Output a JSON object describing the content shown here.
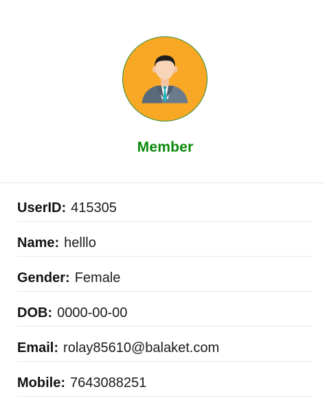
{
  "profile": {
    "avatar_icon": "businessman-avatar-icon",
    "role": "Member",
    "colors": {
      "role_text": "#0a8a0a",
      "avatar_bg": "#f9a825",
      "avatar_border": "#2e8b2e"
    }
  },
  "info": [
    {
      "key": "UserID:",
      "value": "415305"
    },
    {
      "key": "Name:",
      "value": "helllo"
    },
    {
      "key": "Gender:",
      "value": "Female"
    },
    {
      "key": "DOB:",
      "value": "0000-00-00"
    },
    {
      "key": "Email:",
      "value": "rolay85610@balaket.com"
    },
    {
      "key": "Mobile:",
      "value": "7643088251"
    }
  ]
}
